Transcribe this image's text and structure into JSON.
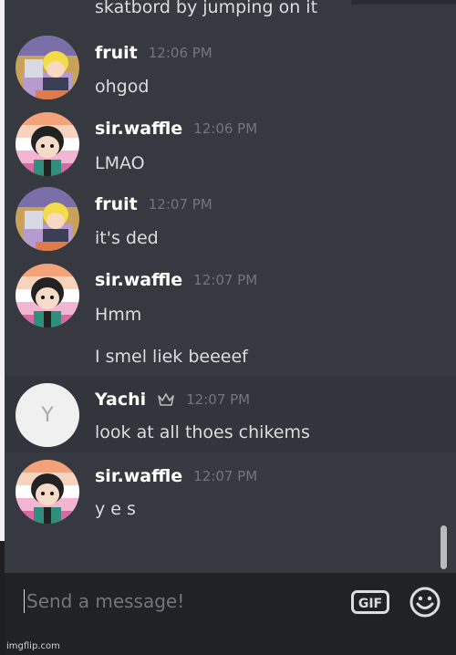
{
  "messages": [
    {
      "user": "fruit",
      "time": "12:06 PM",
      "lines": [
        "ohgod"
      ]
    },
    {
      "user": "sir.waffle",
      "time": "12:06 PM",
      "lines": [
        "LMAO"
      ]
    },
    {
      "user": "fruit",
      "time": "12:07 PM",
      "lines": [
        "it's ded"
      ]
    },
    {
      "user": "sir.waffle",
      "time": "12:07 PM",
      "lines": [
        "Hmm",
        "I smel liek beeeef"
      ]
    },
    {
      "user": "Yachi",
      "time": "12:07 PM",
      "avatar_letter": "Y",
      "lines": [
        "look at all thoes chikems"
      ]
    },
    {
      "user": "sir.waffle",
      "time": "12:07 PM",
      "lines": [
        "y e s"
      ]
    }
  ],
  "partial_message": "skatbord by jumping on it",
  "composer": {
    "placeholder": "Send a message!",
    "gif_label": "GIF"
  },
  "watermark": "imgflip.com",
  "icons": {
    "owner": "crown-icon",
    "gif": "gif-icon",
    "emoji": "emoji-icon"
  },
  "colors": {
    "background": "#36393f",
    "composer": "#202225",
    "username": "#ffffff",
    "text": "#dcddde",
    "timestamp": "#72767d",
    "highlight": "#32353b"
  }
}
